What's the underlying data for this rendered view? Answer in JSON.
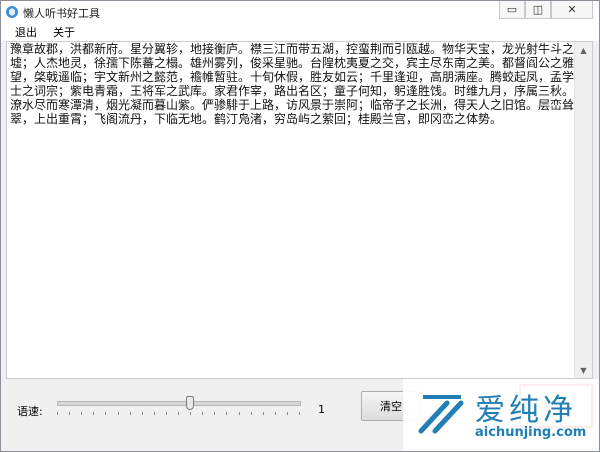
{
  "window": {
    "title": "懒人听书好工具",
    "controls": {
      "minimize": "▭",
      "maximize": "◫",
      "close": "✕"
    }
  },
  "menu": {
    "items": [
      "退出",
      "关于"
    ]
  },
  "text_area": {
    "content": "豫章故郡，洪都新府。星分翼轸，地接衡庐。襟三江而带五湖，控蛮荆而引瓯越。物华天宝，龙光射牛斗之墟；人杰地灵，徐孺下陈蕃之榻。雄州雾列，俊采星驰。台隍枕夷夏之交，宾主尽东南之美。都督阎公之雅望，棨戟遥临；宇文新州之懿范，襜帷暂驻。十旬休假，胜友如云；千里逢迎，高朋满座。腾蛟起凤，孟学士之词宗；紫电青霜，王将军之武库。家君作宰，路出名区；童子何知，躬逢胜饯。时维九月，序属三秋。潦水尽而寒潭清，烟光凝而暮山紫。俨骖騑于上路，访风景于崇阿；临帝子之长洲，得天人之旧馆。层峦耸翠，上出重霄；飞阁流丹，下临无地。鹤汀凫渚，穷岛屿之萦回；桂殿兰宫，即冈峦之体势。"
  },
  "controls": {
    "speed_label": "语速:",
    "speed_value": "1",
    "speed_level": 0.55,
    "clear_button": "清空"
  },
  "watermark": {
    "name": "爱纯净",
    "url": "aichunjing.com"
  },
  "colors": {
    "highlight": "#d9262c",
    "brand": "#1f7fb6"
  }
}
